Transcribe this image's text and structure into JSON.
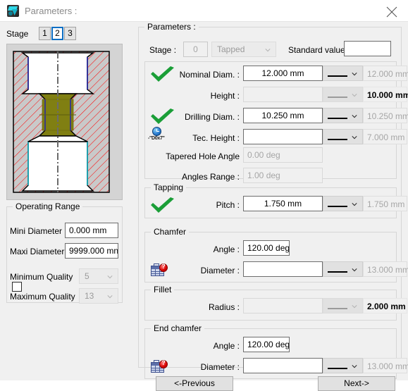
{
  "window": {
    "title": "Parameters :",
    "icon": "app-icon",
    "close_icon": "close-icon"
  },
  "left": {
    "stage_label": "Stage",
    "stage_tabs": [
      "1",
      "2",
      "3"
    ],
    "selected_stage": "2",
    "operating_range": {
      "legend": "Operating Range",
      "mini_diameter_label": "Mini Diameter",
      "mini_diameter_value": "0.000 mm",
      "maxi_diameter_label": "Maxi Diameter",
      "maxi_diameter_value": "9999.000 mn",
      "minimum_quality_label": "Minimum Quality",
      "minimum_quality_value": "5",
      "maximum_quality_label": "Maximum Quality",
      "maximum_quality_value": "13"
    }
  },
  "right": {
    "parameters": {
      "legend": "Parameters :",
      "stage_label": "Stage :",
      "stage_value": "0",
      "type_value": "Tapped",
      "standard_value_label": "Standard value :",
      "standard_value": ""
    },
    "rows": {
      "nominal_diam": {
        "label": "Nominal Diam. :",
        "value": "12.000 mm",
        "combo_value": "",
        "readout": "12.000 mm",
        "status": "check"
      },
      "height": {
        "label": "Height :",
        "value": "",
        "combo_value": "",
        "readout": "10.000 mm",
        "status": "none"
      },
      "drilling_diam": {
        "label": "Drilling Diam. :",
        "value": "10.250 mm",
        "combo_value": "",
        "readout": "10.250 mm",
        "status": "check"
      },
      "tec_height": {
        "label": "Tec. Height :",
        "value": "",
        "combo_value": "",
        "readout": "7.000 mm",
        "status": "clock",
        "icon_caption": "-\"D0x7\""
      },
      "tapered_hole_angle": {
        "label": "Tapered Hole Angle",
        "value": "0.00 deg"
      },
      "angles_range": {
        "label": "Angles Range :",
        "value": "1.00 deg"
      }
    },
    "tapping": {
      "legend": "Tapping",
      "pitch_label": "Pitch :",
      "pitch_value": "1.750 mm",
      "pitch_readout": "1.750 mm",
      "status": "check"
    },
    "chamfer": {
      "legend": "Chamfer",
      "angle_label": "Angle :",
      "angle_value": "120.00 deg",
      "diameter_label": "Diameter :",
      "diameter_value": "",
      "diameter_readout": "13.000 mm",
      "status": "table-question"
    },
    "fillet": {
      "legend": "Fillet",
      "radius_label": "Radius :",
      "radius_value": "",
      "radius_readout": "2.000 mm"
    },
    "end_chamfer": {
      "legend": "End chamfer",
      "angle_label": "Angle :",
      "angle_value": "120.00 deg",
      "diameter_label": "Diameter :",
      "diameter_value": "",
      "diameter_readout": "13.000 mm",
      "status": "table-question"
    }
  },
  "footer": {
    "previous_label": "<-Previous",
    "next_label": "Next->"
  },
  "colors": {
    "accent_blue": "#0d6fc4",
    "check_green": "#1a9e37",
    "hatch_red": "#ff0000",
    "thread_olive": "#807f12",
    "panel_bg": "#f0f0f0"
  }
}
